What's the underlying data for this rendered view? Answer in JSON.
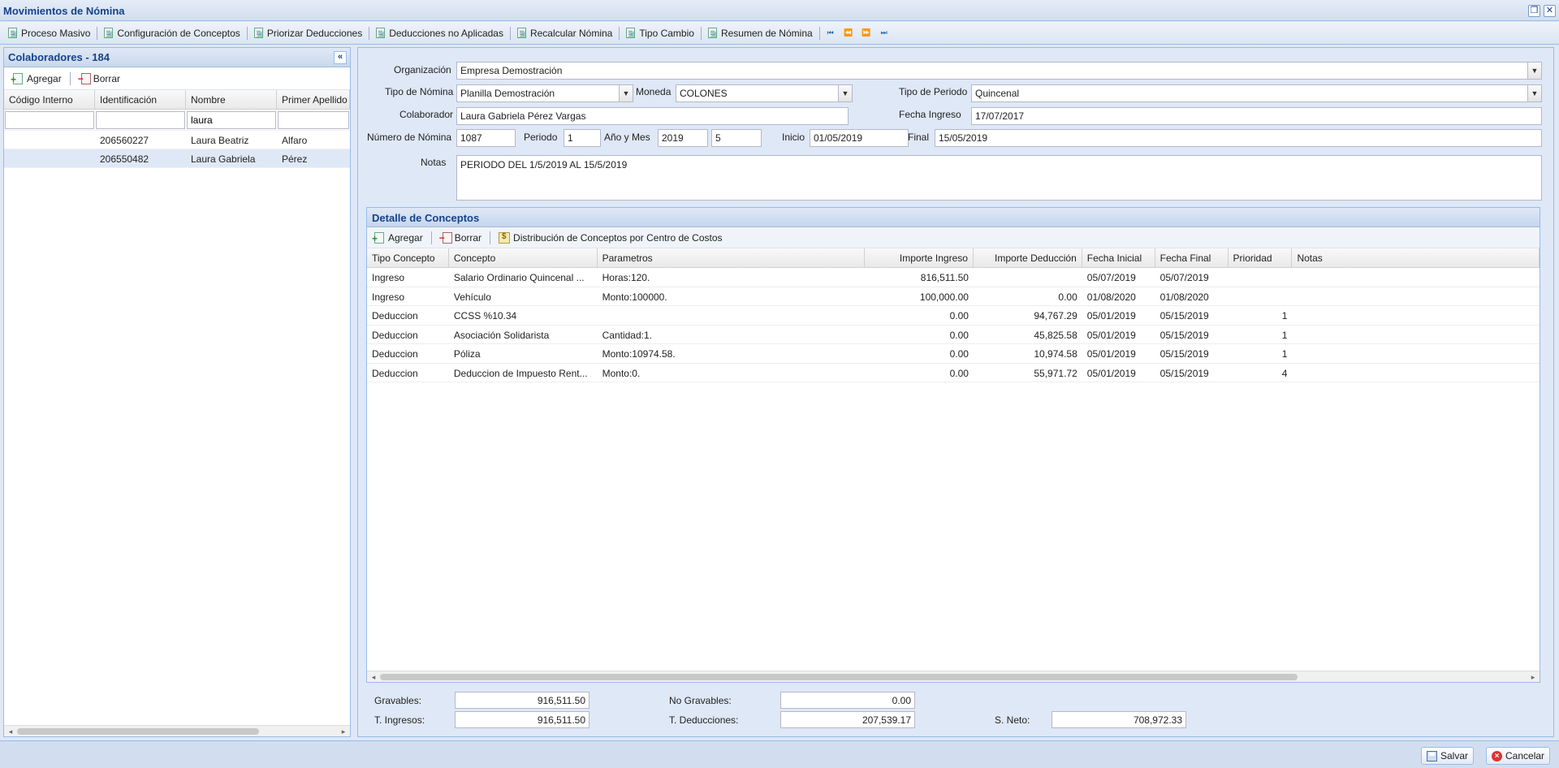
{
  "window": {
    "title": "Movimientos de Nómina"
  },
  "toolbar": {
    "items": [
      "Proceso Masivo",
      "Configuración de Conceptos",
      "Priorizar Deducciones",
      "Deducciones no Aplicadas",
      "Recalcular Nómina",
      "Tipo Cambio",
      "Resumen de Nómina"
    ]
  },
  "collaborators": {
    "title": "Colaboradores - 184",
    "add_label": "Agregar",
    "delete_label": "Borrar",
    "columns": [
      "Código Interno",
      "Identificación",
      "Nombre",
      "Primer Apellido"
    ],
    "filter": {
      "nombre": "laura"
    },
    "rows": [
      {
        "codigo": "",
        "identificacion": "206560227",
        "nombre": "Laura Beatriz",
        "apellido": "Alfaro"
      },
      {
        "codigo": "",
        "identificacion": "206550482",
        "nombre": "Laura Gabriela",
        "apellido": "Pérez"
      }
    ]
  },
  "form": {
    "organizacion_label": "Organización",
    "organizacion": "Empresa Demostración",
    "tipo_nomina_label": "Tipo de Nómina",
    "tipo_nomina": "Planilla Demostración",
    "moneda_label": "Moneda",
    "moneda": "COLONES",
    "tipo_periodo_label": "Tipo de Periodo",
    "tipo_periodo": "Quincenal",
    "colaborador_label": "Colaborador",
    "colaborador": "Laura Gabriela Pérez Vargas",
    "fecha_ingreso_label": "Fecha Ingreso",
    "fecha_ingreso": "17/07/2017",
    "numero_nomina_label": "Número de Nómina",
    "numero_nomina": "1087",
    "periodo_label": "Periodo",
    "periodo": "1",
    "anio_mes_label": "Año y Mes",
    "anio": "2019",
    "mes": "5",
    "inicio_label": "Inicio",
    "inicio": "01/05/2019",
    "final_label": "Final",
    "final": "15/05/2019",
    "notas_label": "Notas",
    "notas": "PERIODO DEL 1/5/2019 AL 15/5/2019"
  },
  "detail": {
    "title": "Detalle de Conceptos",
    "add_label": "Agregar",
    "delete_label": "Borrar",
    "distribution_label": "Distribución de Conceptos por Centro de Costos",
    "columns": [
      "Tipo Concepto",
      "Concepto",
      "Parametros",
      "Importe Ingreso",
      "Importe Deducción",
      "Fecha Inicial",
      "Fecha Final",
      "Prioridad",
      "Notas"
    ],
    "rows": [
      {
        "tipo": "Ingreso",
        "concepto": "Salario Ordinario Quincenal ...",
        "parametros": "Horas:120.",
        "ingreso": "816,511.50",
        "deduccion": "",
        "fi": "",
        "ff": "05/07/2019",
        "ff2": "05/07/2019",
        "prioridad": "",
        "notas": ""
      },
      {
        "tipo": "Ingreso",
        "concepto": "Vehículo",
        "parametros": "Monto:100000.",
        "ingreso": "100,000.00",
        "deduccion": "0.00",
        "fi": "",
        "ff": "01/08/2020",
        "ff2": "01/08/2020",
        "prioridad": "",
        "notas": ""
      },
      {
        "tipo": "Deduccion",
        "concepto": "CCSS %10.34",
        "parametros": "",
        "ingreso": "0.00",
        "deduccion": "94,767.29",
        "fi": "",
        "ff": "05/01/2019",
        "ff2": "05/15/2019",
        "prioridad": "1",
        "notas": ""
      },
      {
        "tipo": "Deduccion",
        "concepto": "Asociación Solidarista",
        "parametros": "Cantidad:1.",
        "ingreso": "0.00",
        "deduccion": "45,825.58",
        "fi": "",
        "ff": "05/01/2019",
        "ff2": "05/15/2019",
        "prioridad": "1",
        "notas": ""
      },
      {
        "tipo": "Deduccion",
        "concepto": "Póliza",
        "parametros": "Monto:10974.58.",
        "ingreso": "0.00",
        "deduccion": "10,974.58",
        "fi": "",
        "ff": "05/01/2019",
        "ff2": "05/15/2019",
        "prioridad": "1",
        "notas": ""
      },
      {
        "tipo": "Deduccion",
        "concepto": "Deduccion de Impuesto Rent...",
        "parametros": "Monto:0.",
        "ingreso": "0.00",
        "deduccion": "55,971.72",
        "fi": "",
        "ff": "05/01/2019",
        "ff2": "05/15/2019",
        "prioridad": "4",
        "notas": ""
      }
    ]
  },
  "totals": {
    "gravables_label": "Gravables:",
    "gravables": "916,511.50",
    "no_gravables_label": "No Gravables:",
    "no_gravables": "0.00",
    "t_ingresos_label": "T. Ingresos:",
    "t_ingresos": "916,511.50",
    "t_deducciones_label": "T. Deducciones:",
    "t_deducciones": "207,539.17",
    "s_neto_label": "S. Neto:",
    "s_neto": "708,972.33"
  },
  "footer": {
    "save_label": "Salvar",
    "cancel_label": "Cancelar"
  }
}
